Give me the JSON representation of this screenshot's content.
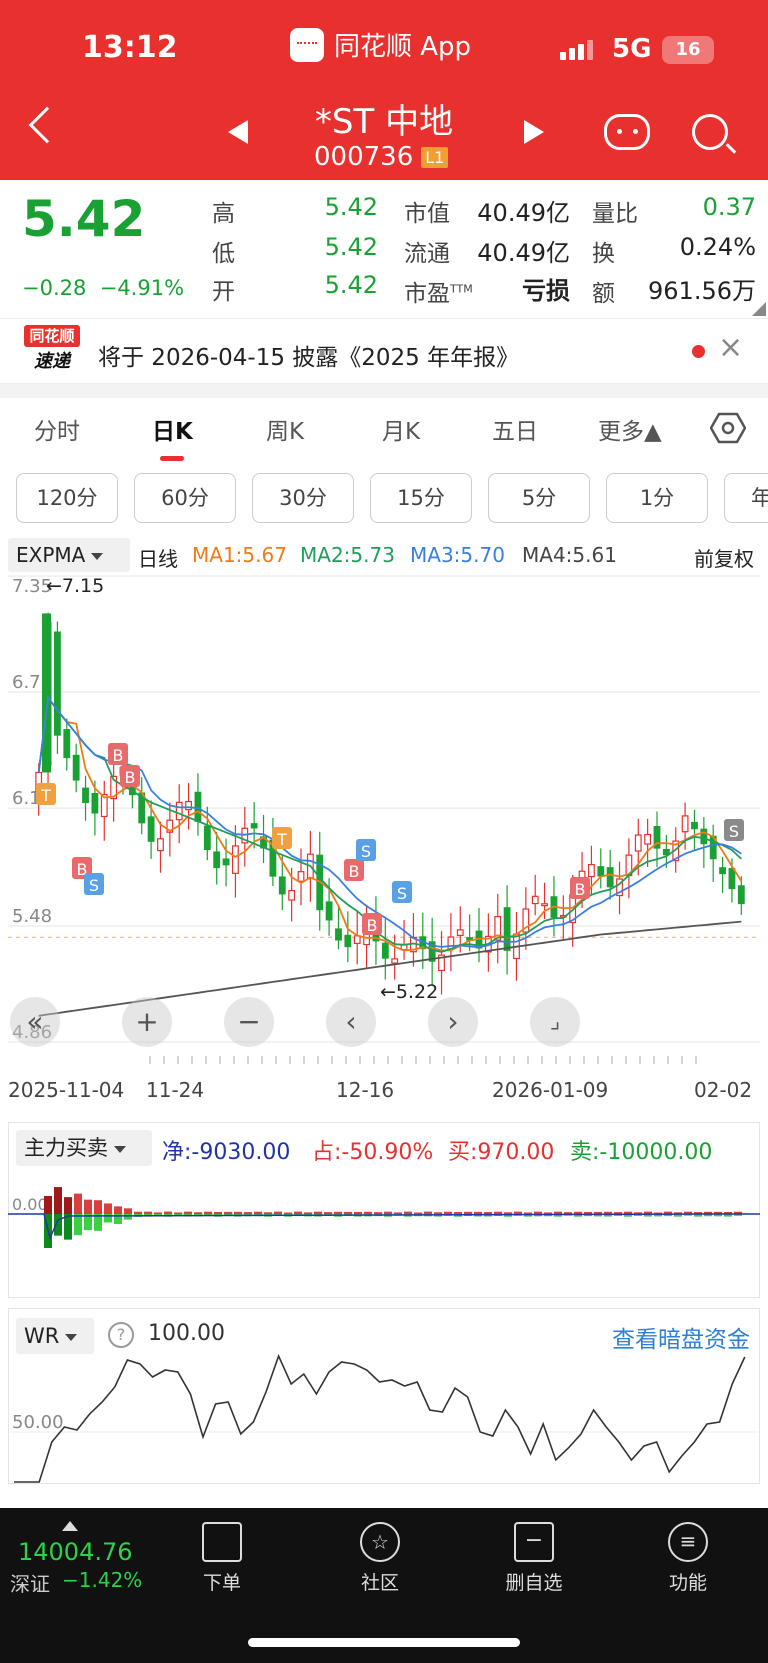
{
  "status": {
    "time": "13:12",
    "app": "同花顺 App",
    "network": "5G",
    "battery": "16"
  },
  "header": {
    "stock_name": "*ST 中地",
    "stock_code": "000736",
    "level_badge": "L1"
  },
  "quote": {
    "price": "5.42",
    "change": "−0.28",
    "change_pct": "−4.91%",
    "high_label": "高",
    "high": "5.42",
    "low_label": "低",
    "low": "5.42",
    "open_label": "开",
    "open": "5.42",
    "mcap_label": "市值",
    "mcap": "40.49亿",
    "float_label": "流通",
    "float": "40.49亿",
    "pe_label": "市盈",
    "pe_sup": "TTM",
    "pe": "亏损",
    "vr_label": "量比",
    "vr": "0.37",
    "turn_label": "换",
    "turn": "0.24%",
    "amt_label": "额",
    "amt": "961.56万"
  },
  "news": {
    "logo_top": "同花顺",
    "logo_bottom": "速递",
    "text": "将于 2026-04-15 披露《2025 年年报》"
  },
  "tabs": [
    "分时",
    "日K",
    "周K",
    "月K",
    "五日",
    "更多▲"
  ],
  "periods": [
    "120分",
    "60分",
    "30分",
    "15分",
    "5分",
    "1分",
    "年"
  ],
  "ma_row": {
    "indicator": "EXPMA",
    "kind": "日线",
    "ma1": "MA1:5.67",
    "ma2": "MA2:5.73",
    "ma3": "MA3:5.70",
    "ma4": "MA4:5.61",
    "adjust": "前复权"
  },
  "chart_data": {
    "type": "candlestick",
    "y_ticks": [
      "7.35",
      "6.73",
      "6.11",
      "5.48",
      "4.86"
    ],
    "ylim": [
      4.86,
      7.35
    ],
    "high_mark": "←7.15",
    "low_mark": "←5.22",
    "x_labels": [
      "2025-11-04",
      "11-24",
      "12-16",
      "2026-01-09",
      "02-02"
    ],
    "markers": [
      "T",
      "B",
      "B",
      "B",
      "S",
      "T",
      "B",
      "S",
      "B",
      "S",
      "B",
      "S"
    ],
    "series": [
      {
        "name": "MA1",
        "color": "#f07a1a"
      },
      {
        "name": "MA2",
        "color": "#1f9e5a"
      },
      {
        "name": "MA3",
        "color": "#3a7fe0"
      },
      {
        "name": "MA4",
        "color": "#555555"
      }
    ]
  },
  "fund_flow": {
    "selector": "主力买卖",
    "net": "净:-9030.00",
    "ratio": "占:-50.90%",
    "buy": "买:970.00",
    "sell": "卖:-10000.00",
    "axis_label": "0.00"
  },
  "wr": {
    "selector": "WR",
    "value": "100.00",
    "axis_label": "50.00",
    "link": "查看暗盘资金"
  },
  "bottom": {
    "index_value": "14004.76",
    "index_name": "深证",
    "index_change": "−1.42%",
    "nav": [
      "下单",
      "社区",
      "删自选",
      "功能"
    ]
  }
}
